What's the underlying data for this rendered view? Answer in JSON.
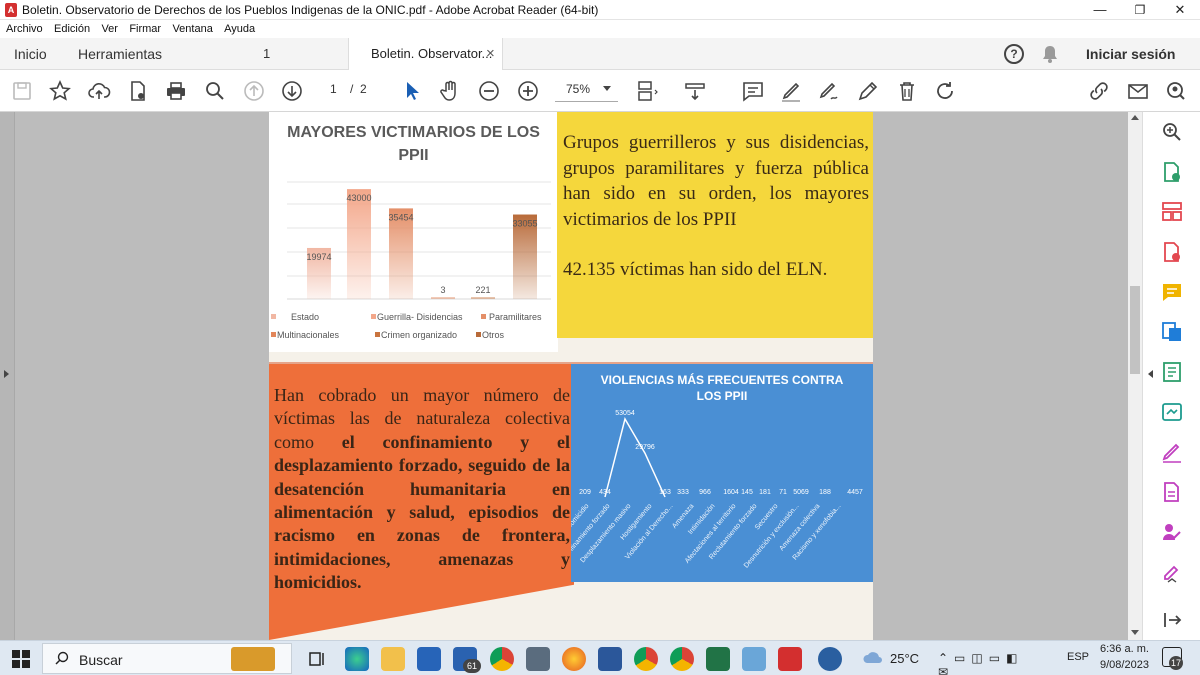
{
  "window": {
    "title": "Boletin. Observatorio de Derechos de los Pueblos Indigenas de la ONIC.pdf - Adobe Acrobat Reader (64-bit)",
    "minimize": "—",
    "maximize": "❐",
    "close": "✕"
  },
  "menu": [
    "Archivo",
    "Edición",
    "Ver",
    "Firmar",
    "Ventana",
    "Ayuda"
  ],
  "tabs": {
    "home": "Inicio",
    "tools": "Herramientas",
    "tab_count": "1",
    "document": "Boletin. Observator...",
    "close": "×",
    "help": "?",
    "signin": "Iniciar sesión"
  },
  "toolbar": {
    "page_current": "1",
    "page_sep": "/",
    "page_total": "2",
    "zoom": "75%"
  },
  "document": {
    "chart1": {
      "title_line1": "MAYORES VICTIMARIOS DE LOS",
      "title_line2": "PPII"
    },
    "yellow_paragraph1": "Grupos guerrilleros y sus disidencias, grupos paramilitares y fuerza pública han sido en su orden, los mayores victimarios de los PPII",
    "yellow_paragraph2": "42.135 víctimas han sido del ELN.",
    "orange_text_normal": "Han cobrado un mayor número de víctimas las de naturaleza colectiva como ",
    "orange_text_bold": "el confinamiento y el desplazamiento forzado, seguido de la desatención humanitaria en alimentación y salud, episodios de racismo en zonas de frontera, intimidaciones, amenazas y homicidios.",
    "chart2": {
      "title_line1": "VIOLENCIAS MÁS FRECUENTES CONTRA",
      "title_line2": "LOS PPII"
    }
  },
  "taskbar": {
    "search": "Buscar",
    "mail_badge": "61",
    "temperature": "25°C",
    "language": "ESP",
    "time": "6:36 a. m.",
    "date": "9/08/2023",
    "notif_count": "17"
  },
  "colors": {
    "yellow": "#f5d73c",
    "orange": "#ee6f3a",
    "blue": "#4a8fd4",
    "acrobat_red": "#d32f2f"
  },
  "chart_data": [
    {
      "type": "bar",
      "title": "MAYORES VICTIMARIOS DE LOS PPII",
      "categories": [
        "Estado",
        "Guerrilla- Disidencias",
        "Paramilitares",
        "Multinacionales",
        "Crimen organizado",
        "Otros"
      ],
      "values": [
        19974,
        43000,
        35454,
        3,
        221,
        33055
      ],
      "colors": [
        "#f1b7a3",
        "#f3a78a",
        "#e48f68",
        "#e2865a",
        "#c9743f",
        "#b86a39"
      ],
      "legend_placement": "bottom"
    },
    {
      "type": "line",
      "title": "VIOLENCIAS MÁS FRECUENTES CONTRA LOS PPII",
      "categories": [
        "Homicidio",
        "Confinamiento forzado",
        "Desplazamiento masivo",
        "Hostigamiento",
        "Violación al Derecho...",
        "Amenaza",
        "Intimidación",
        "Afectaciones al territorio",
        "Reclutamiento forzado",
        "Secuestro",
        "Desnutrición y exclusión...",
        "Amenaza colectiva",
        "Racismo y xenofobia..."
      ],
      "value_labels": [
        "209",
        "434",
        "53054",
        "29796",
        "163",
        "333",
        "966",
        "1604",
        "145",
        "181",
        "71",
        "5069",
        "188",
        "4457"
      ],
      "values": [
        209,
        434,
        53054,
        29796,
        163,
        333,
        966,
        1604,
        145,
        181,
        71,
        5069,
        188,
        4457
      ]
    }
  ]
}
